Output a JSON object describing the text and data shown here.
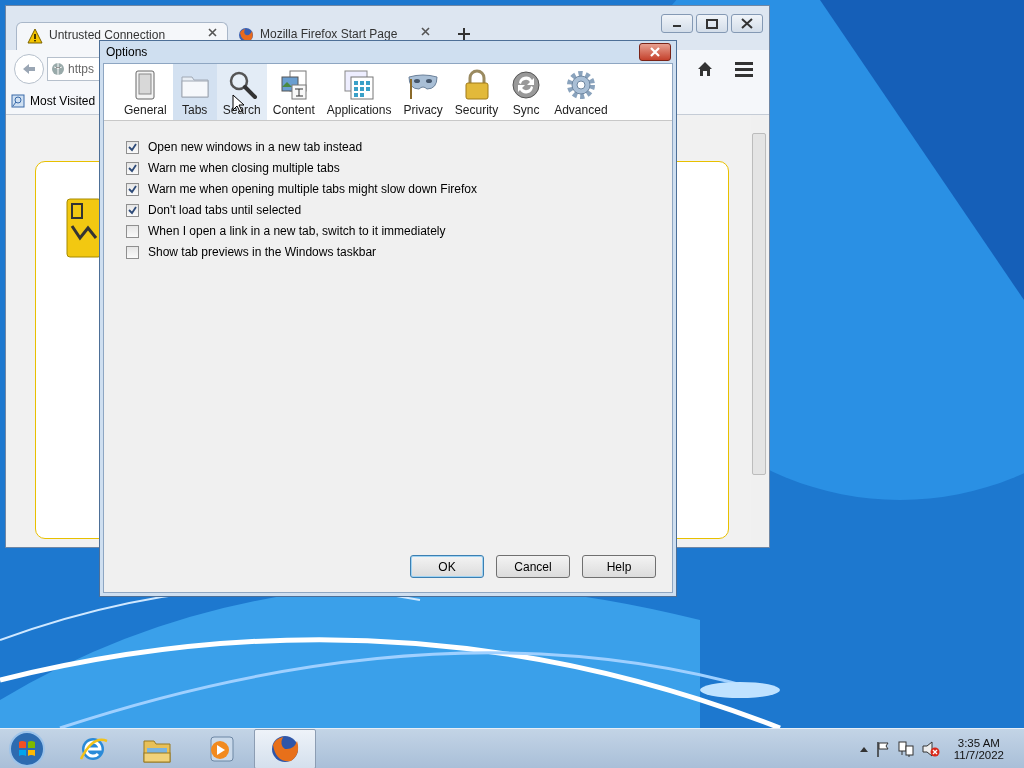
{
  "browser": {
    "tabs": [
      {
        "title": "Untrusted Connection",
        "kind": "warning",
        "selected": true
      },
      {
        "title": "Mozilla Firefox Start Page",
        "kind": "firefox",
        "selected": false
      }
    ],
    "address": "https",
    "bookmarks": [
      {
        "label": "Most Visited"
      }
    ]
  },
  "dialog": {
    "title": "Options",
    "panes": [
      {
        "label": "General",
        "kind": "general",
        "selected": false,
        "hover": false
      },
      {
        "label": "Tabs",
        "kind": "tabs",
        "selected": true,
        "hover": false
      },
      {
        "label": "Search",
        "kind": "search",
        "selected": false,
        "hover": true
      },
      {
        "label": "Content",
        "kind": "content",
        "selected": false,
        "hover": false
      },
      {
        "label": "Applications",
        "kind": "applications",
        "selected": false,
        "hover": false
      },
      {
        "label": "Privacy",
        "kind": "privacy",
        "selected": false,
        "hover": false
      },
      {
        "label": "Security",
        "kind": "security",
        "selected": false,
        "hover": false
      },
      {
        "label": "Sync",
        "kind": "sync",
        "selected": false,
        "hover": false
      },
      {
        "label": "Advanced",
        "kind": "advanced",
        "selected": false,
        "hover": false
      }
    ],
    "options": [
      {
        "label": "Open new windows in a new tab instead",
        "checked": true
      },
      {
        "label": "Warn me when closing multiple tabs",
        "checked": true
      },
      {
        "label": "Warn me when opening multiple tabs might slow down Firefox",
        "checked": true
      },
      {
        "label": "Don't load tabs until selected",
        "checked": true
      },
      {
        "label": "When I open a link in a new tab, switch to it immediately",
        "checked": false
      },
      {
        "label": "Show tab previews in the Windows taskbar",
        "checked": false
      }
    ],
    "buttons": [
      {
        "label": "OK",
        "default": true
      },
      {
        "label": "Cancel",
        "default": false
      },
      {
        "label": "Help",
        "default": false
      }
    ]
  },
  "taskbar": {
    "apps": [
      {
        "kind": "ie",
        "active": false
      },
      {
        "kind": "explorer",
        "active": false
      },
      {
        "kind": "media",
        "active": false
      },
      {
        "kind": "firefox",
        "active": true
      }
    ],
    "clock": {
      "time": "3:35 AM",
      "date": "11/7/2022"
    }
  }
}
